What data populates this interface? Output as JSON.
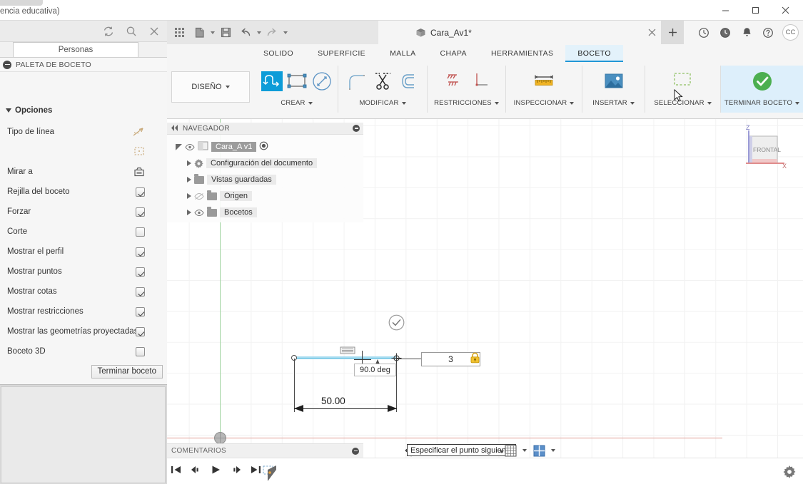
{
  "os_window": {
    "title": "encia educativa)",
    "minimize": "minimize-icon",
    "maximize": "maximize-icon",
    "close": "close-icon"
  },
  "left_panel": {
    "toolbar_icons": [
      "refresh-icon",
      "search-icon",
      "close-icon"
    ],
    "tab_label": "Personas",
    "sketch_palette_title": "PALETA DE BOCETO",
    "options_header": "Opciones",
    "options": [
      {
        "label": "Tipo de línea",
        "control": "linetype-icon"
      },
      {
        "label": "",
        "control": "construction-icon"
      },
      {
        "label": "Mirar a",
        "control": "lookat-icon"
      },
      {
        "label": "Rejilla del boceto",
        "control": "checkbox",
        "checked": true
      },
      {
        "label": "Forzar",
        "control": "checkbox",
        "checked": true
      },
      {
        "label": "Corte",
        "control": "checkbox",
        "checked": false
      },
      {
        "label": "Mostrar el perfil",
        "control": "checkbox",
        "checked": true
      },
      {
        "label": "Mostrar puntos",
        "control": "checkbox",
        "checked": true
      },
      {
        "label": "Mostrar cotas",
        "control": "checkbox",
        "checked": true
      },
      {
        "label": "Mostrar restricciones",
        "control": "checkbox",
        "checked": true
      },
      {
        "label": "Mostrar las geometrías proyectadas",
        "control": "checkbox",
        "checked": true
      },
      {
        "label": "Boceto 3D",
        "control": "checkbox",
        "checked": false
      }
    ],
    "finish_button": "Terminar boceto"
  },
  "fusion": {
    "quick_access": [
      "grid-apps-icon",
      "new-document-icon",
      "save-icon",
      "undo-icon",
      "redo-icon"
    ],
    "document_tab": {
      "title": "Cara_Av1*",
      "icon": "cube-icon",
      "close": "close-icon"
    },
    "new_tab_button": "+",
    "right_icons": [
      "job-status-icon",
      "recent-icon",
      "notifications-icon",
      "help-icon"
    ],
    "avatar_initials": "CC",
    "workspace_selector": "DISEÑO",
    "ribbon_tabs": [
      {
        "label": "SOLIDO",
        "active": false
      },
      {
        "label": "SUPERFICIE",
        "active": false
      },
      {
        "label": "MALLA",
        "active": false
      },
      {
        "label": "CHAPA",
        "active": false
      },
      {
        "label": "HERRAMIENTAS",
        "active": false
      },
      {
        "label": "BOCETO",
        "active": true
      }
    ],
    "panels": [
      {
        "label": "CREAR",
        "has_dropdown": true,
        "items": [
          "line-tool-icon",
          "rectangle-icon",
          "circle-icon"
        ]
      },
      {
        "label": "MODIFICAR",
        "has_dropdown": true,
        "items": [
          "fillet-icon",
          "trim-scissors-icon",
          "offset-icon"
        ]
      },
      {
        "label": "RESTRICCIONES",
        "has_dropdown": true,
        "items": [
          "fix-constraint-icon",
          "perpendicular-constraint-icon"
        ]
      },
      {
        "label": "INSPECCIONAR",
        "has_dropdown": true,
        "items": [
          "measure-icon"
        ]
      },
      {
        "label": "INSERTAR",
        "has_dropdown": true,
        "items": [
          "insert-image-icon"
        ]
      },
      {
        "label": "SELECCIONAR",
        "has_dropdown": true,
        "items": [
          "selection-window-icon"
        ]
      },
      {
        "label": "TERMINAR BOCETO",
        "has_dropdown": true,
        "items": [
          "finish-sketch-check-icon"
        ],
        "highlighted": true
      }
    ],
    "navigator": {
      "title": "NAVEGADOR",
      "collapse_icon": "collapse-left-icon",
      "tree": [
        {
          "label": "Cara_A v1",
          "depth": 0,
          "selected": true,
          "icon": "component-icon",
          "expander": "open"
        },
        {
          "label": "Configuración del documento",
          "depth": 1,
          "icon": "gear-icon",
          "expander": "closed"
        },
        {
          "label": "Vistas guardadas",
          "depth": 1,
          "icon": "folder-icon",
          "expander": "closed"
        },
        {
          "label": "Origen",
          "depth": 1,
          "icon": "folder-icon",
          "expander": "closed",
          "hidden_eye": true
        },
        {
          "label": "Bocetos",
          "depth": 1,
          "icon": "folder-icon",
          "expander": "closed"
        }
      ]
    },
    "viewcube": {
      "face_label": "FRONTAL",
      "axis_z": "Z",
      "axis_x": "X"
    },
    "comments_bar": {
      "title": "COMENTARIOS"
    },
    "cursor_tooltip": "Especificar el punto siguiente",
    "bottom_nav_icons": [
      "orbit-icon",
      "pan-icon",
      "zoom-icon",
      "display-settings-icon",
      "grid-snaps-icon",
      "viewports-icon"
    ],
    "timeline": {
      "controls": [
        "go-to-start-icon",
        "step-back-icon",
        "play-icon",
        "step-forward-icon",
        "go-to-end-icon"
      ],
      "nodes": [
        "sketch-node-icon"
      ]
    },
    "settings_icon": "gear-icon"
  },
  "sketch": {
    "linear_dimension": "50.00",
    "angular_dimension": "90.0 deg",
    "value_input": "3",
    "lock_icon": "lock-icon",
    "constraint_markers": [
      "perpendicular-marker",
      "coincident-point",
      "check-circle"
    ]
  },
  "colors": {
    "accent_blue": "#2196d6",
    "highlight_panel": "#ddeffb",
    "sketch_line": "#6fc4e4",
    "sketch_highlight": "#a8dcf0",
    "axis_x_red": "#e09a93",
    "axis_y_green": "#9ed39e",
    "check_green": "#4caf50",
    "lock_yellow": "#f2c230",
    "tree_selected": "#9c9c9c"
  }
}
